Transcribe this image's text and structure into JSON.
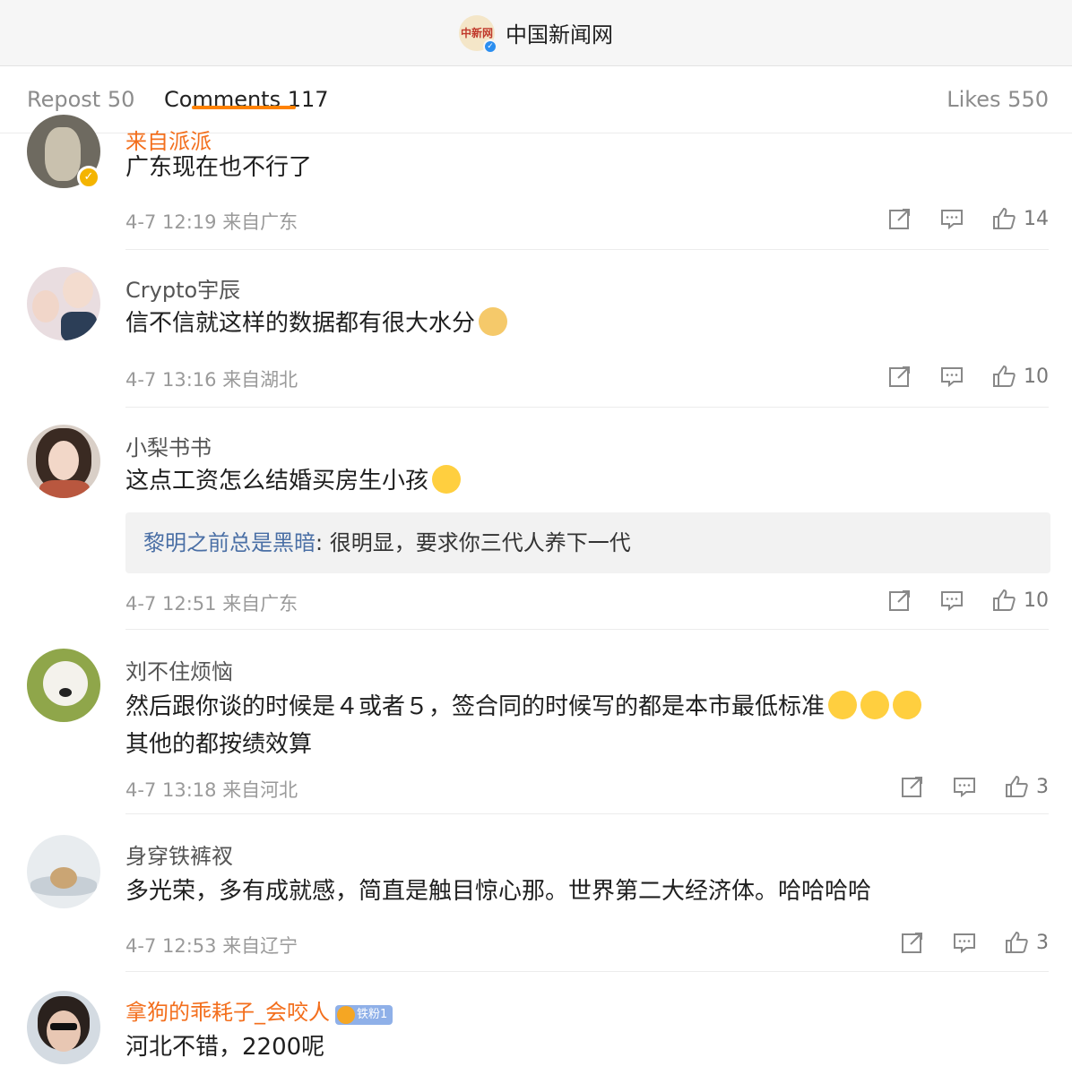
{
  "header": {
    "account_name": "中国新闻网",
    "logo_text": "中新网"
  },
  "tabs": [
    {
      "label": "Repost 50"
    },
    {
      "label": "Comments 117"
    },
    {
      "label": "Likes 550"
    }
  ],
  "comments": [
    {
      "username": "来自派派",
      "text": "广东现在也不行了",
      "time": "4-7 12:19",
      "location": "来自广东",
      "likes": "14"
    },
    {
      "username": "Crypto宇辰",
      "text": "信不信就这样的数据都有很大水分",
      "time": "4-7 13:16",
      "location": "来自湖北",
      "likes": "10"
    },
    {
      "username": "小梨书书",
      "text": "这点工资怎么结婚买房生小孩",
      "time": "4-7 12:51",
      "location": "来自广东",
      "likes": "10",
      "reply": {
        "user": "黎明之前总是黑暗",
        "text": ": 很明显，要求你三代人养下一代"
      }
    },
    {
      "username": "刘不住烦恼",
      "text_line1": "然后跟你谈的时候是４或者５，签合同的时候写的都是本市最低标准",
      "text_line2": "其他的都按绩效算",
      "time": "4-7 13:18",
      "location": "来自河北",
      "likes": "3"
    },
    {
      "username": "身穿铁裤衩",
      "text": "多光荣，多有成就感，简直是触目惊心那。世界第二大经济体。哈哈哈哈",
      "time": "4-7 12:53",
      "location": "来自辽宁",
      "likes": "3"
    },
    {
      "username": "拿狗的乖耗子_会咬人",
      "badge": "铁粉1",
      "text": "河北不错，2200呢"
    }
  ],
  "colors": {
    "accent": "#ff8200",
    "orange_name": "#f36f1d",
    "reply_user": "#4a6fa5"
  },
  "icons": {
    "repost": "share-icon",
    "comment": "comment-icon",
    "like": "thumbs-up-icon"
  }
}
